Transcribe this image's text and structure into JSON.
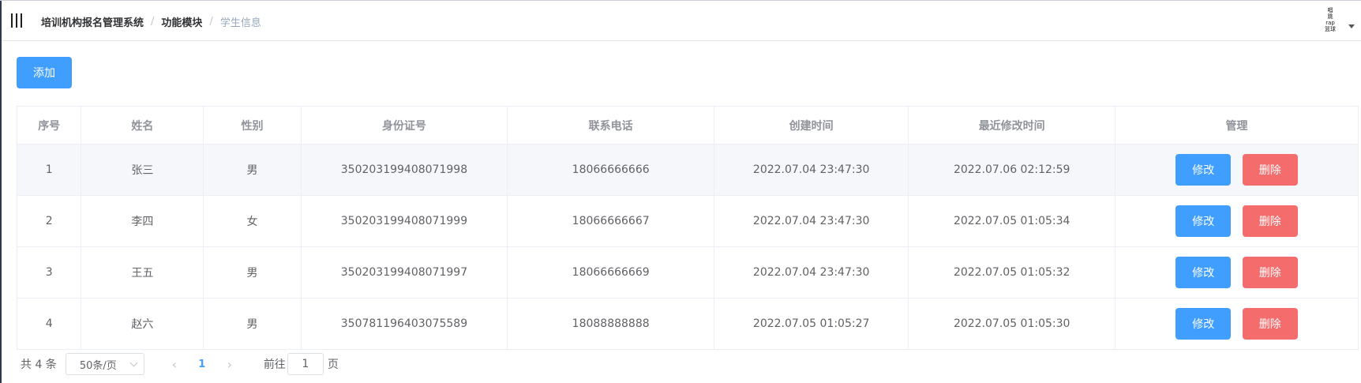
{
  "header": {
    "breadcrumb": [
      "培训机构报名管理系统",
      "功能模块",
      "学生信息"
    ],
    "separator": "/",
    "user_avatar_lines": [
      "唱",
      "跳",
      "rap",
      "篮球"
    ]
  },
  "toolbar": {
    "add_label": "添加"
  },
  "table": {
    "columns": [
      "序号",
      "姓名",
      "性别",
      "身份证号",
      "联系电话",
      "创建时间",
      "最近修改时间",
      "管理"
    ],
    "rows": [
      {
        "no": "1",
        "name": "张三",
        "gender": "男",
        "id_card": "350203199408071998",
        "phone": "18066666666",
        "created": "2022.07.04 23:47:30",
        "modified": "2022.07.06 02:12:59"
      },
      {
        "no": "2",
        "name": "李四",
        "gender": "女",
        "id_card": "350203199408071999",
        "phone": "18066666667",
        "created": "2022.07.04 23:47:30",
        "modified": "2022.07.05 01:05:34"
      },
      {
        "no": "3",
        "name": "王五",
        "gender": "男",
        "id_card": "350203199408071997",
        "phone": "18066666669",
        "created": "2022.07.04 23:47:30",
        "modified": "2022.07.05 01:05:32"
      },
      {
        "no": "4",
        "name": "赵六",
        "gender": "男",
        "id_card": "350781196403075589",
        "phone": "18088888888",
        "created": "2022.07.05 01:05:27",
        "modified": "2022.07.05 01:05:30"
      }
    ],
    "edit_label": "修改",
    "delete_label": "删除",
    "hovered_row": 0
  },
  "pager": {
    "total_text": "共 4 条",
    "page_size": "50条/页",
    "prev_glyph": "‹",
    "next_glyph": "›",
    "current_page": "1",
    "goto_label": "前往",
    "goto_value": "1",
    "goto_suffix": "页"
  },
  "colors": {
    "primary": "#409eff",
    "danger": "#f56c6c",
    "hover_row": "#f5f7fa",
    "sidebar_edge": "#2b3a4d"
  },
  "icons": {
    "menu_toggle": "hamburger-vertical-bars-icon",
    "user_caret": "caret-down-icon",
    "page_size_chevron": "chevron-down-icon"
  }
}
